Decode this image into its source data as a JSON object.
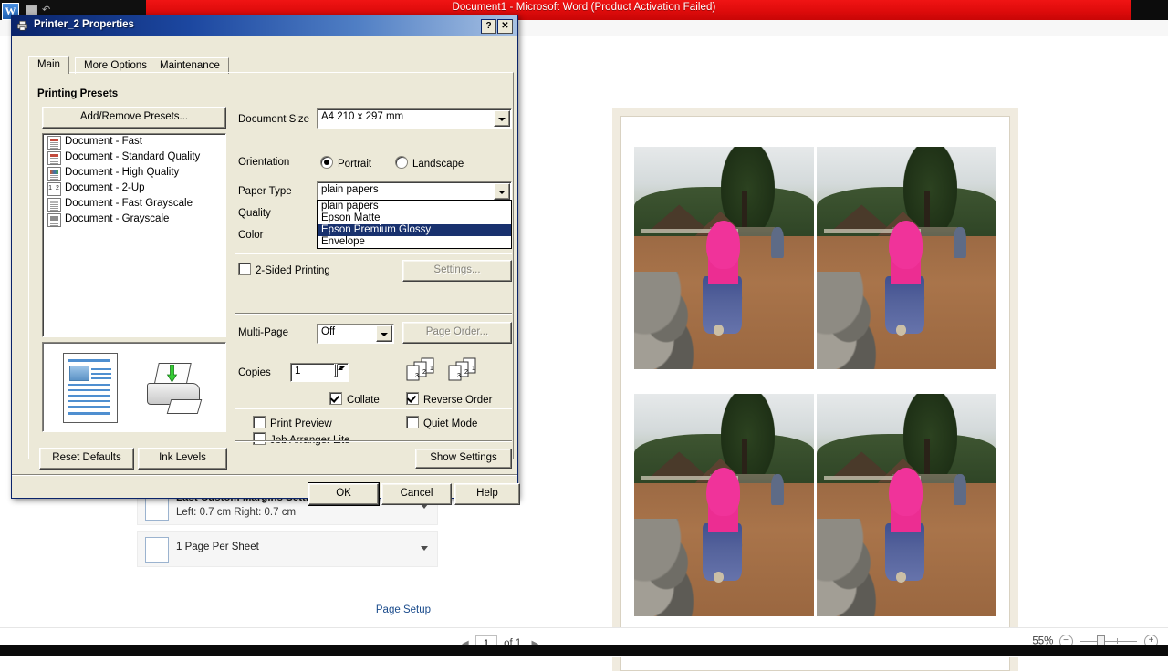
{
  "word": {
    "title": "Document1  -  Microsoft Word (Product Activation Failed)",
    "logo_letter": "W",
    "restore_label": "restore-window",
    "settings_cards": [
      {
        "icon": "margins-icon",
        "line1": "Last Custom Margins Setting",
        "line2": "Left:  0.7 cm    Right:  0.7 cm"
      },
      {
        "icon": "pages-per-sheet-icon",
        "line1": "1 Page Per Sheet",
        "line2": ""
      }
    ],
    "page_setup_link": "Page Setup",
    "page_current": "1",
    "page_of": "of 1",
    "zoom_level": "55%",
    "zoom_out_label": "−",
    "zoom_in_label": "+"
  },
  "dialog": {
    "title": "Printer_2 Properties",
    "help_btn": "?",
    "close_btn": "✕",
    "tabs": [
      {
        "label": "Main",
        "active": true
      },
      {
        "label": "More Options",
        "active": false
      },
      {
        "label": "Maintenance",
        "active": false
      }
    ],
    "presets_header": "Printing Presets",
    "add_remove_presets": "Add/Remove Presets...",
    "presets": [
      "Document - Fast",
      "Document - Standard Quality",
      "Document - High Quality",
      "Document - 2-Up",
      "Document - Fast Grayscale",
      "Document - Grayscale"
    ],
    "reset_defaults": "Reset Defaults",
    "ink_levels": "Ink Levels",
    "document_size_label": "Document Size",
    "document_size_value": "A4 210 x 297 mm",
    "orientation_label": "Orientation",
    "orientation_portrait": "Portrait",
    "orientation_landscape": "Landscape",
    "orientation_selected": "Portrait",
    "paper_type_label": "Paper Type",
    "paper_type_value": "plain papers",
    "paper_type_options": [
      "plain papers",
      "Epson Matte",
      "Epson Premium Glossy",
      "Envelope"
    ],
    "paper_type_highlighted": "Epson Premium Glossy",
    "quality_label": "Quality",
    "color_label": "Color",
    "two_sided_label": "2-Sided Printing",
    "two_sided_checked": false,
    "settings_btn": "Settings...",
    "multipage_label": "Multi-Page",
    "multipage_value": "Off",
    "page_order_btn": "Page Order...",
    "copies_label": "Copies",
    "copies_value": "1",
    "collate_label": "Collate",
    "collate_checked": true,
    "reverse_order_label": "Reverse Order",
    "reverse_order_checked": true,
    "print_preview_label": "Print Preview",
    "print_preview_checked": false,
    "quiet_mode_label": "Quiet Mode",
    "quiet_mode_checked": false,
    "job_arranger_label": "Job Arranger Lite",
    "job_arranger_checked": false,
    "show_settings_btn": "Show Settings",
    "ok_btn": "OK",
    "cancel_btn": "Cancel",
    "help_button": "Help",
    "collate_page_numbers": [
      "1",
      "2",
      "3"
    ],
    "colors": {
      "titlebar_start": "#0a246a",
      "titlebar_end": "#a7c1e3",
      "face": "#ece9d8",
      "highlight": "#18316e",
      "shadow": "#85837a"
    }
  },
  "preview": {
    "sheet_label": "print-preview-page",
    "photo_count": 4,
    "photo_description": "Person in pink hijab and blue skirt standing on rocks beside a dirt road with thatched huts and trees"
  }
}
